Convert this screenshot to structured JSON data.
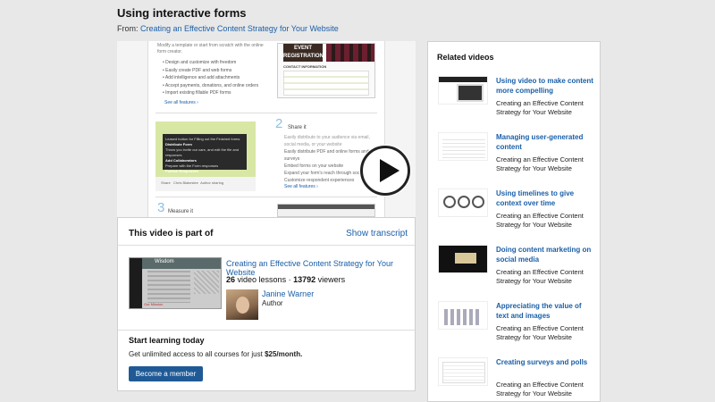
{
  "page": {
    "title": "Using interactive forms",
    "from_label": "From:",
    "from_course": "Creating an Effective Content Strategy for Your Website"
  },
  "video": {
    "blurb": "Modify a template or start from scratch with the online form creator.",
    "features": [
      "Design and customize with freedom",
      "Easily create PDF and web forms",
      "Add intelligence and add attachments",
      "Accept payments, donations, and online orders",
      "Import existing fillable PDF forms"
    ],
    "see_all": "See all features ›",
    "event_card": {
      "banner": "EVENT REGISTRATION",
      "section": "CONTACT INFORMATION"
    },
    "share_shot": {
      "lines": [
        "Leased button for Filling out the Finished forms",
        "Distribute Form",
        "Throw you invite our care, and edit the file and responses",
        "Add Collaborators",
        "Prepare with the Form responses",
        "Publish Responses"
      ],
      "user": "Chris Blakeslee",
      "user_role": "Author sharing",
      "share_label": "Share"
    },
    "step2_num": "2",
    "step2_label": "Share it",
    "share_intro": "Easily distribute to your audience via email, social media, or your website",
    "share_features": [
      "Easily distribute PDF and online forms and surveys",
      "Embed forms on your website",
      "Expand your form's reach through social",
      "Customize respondent experiences"
    ],
    "share_see_all": "See all features ›",
    "step3_num": "3",
    "step3_label": "Measure it",
    "play_label": "Play"
  },
  "course_panel": {
    "part_of": "This video is part of",
    "show_transcript": "Show transcript",
    "thumb_heading": "Wisdom",
    "thumb_caption": "Our Mission",
    "course_title": "Creating an Effective Content Strategy for Your Website",
    "lessons_count": "26",
    "lessons_label": "video lessons ·",
    "viewers_count": "13792",
    "viewers_label": "viewers",
    "author_name": "Janine Warner",
    "author_role": "Author",
    "start_learning": "Start learning today",
    "access_text": "Get unlimited access to all courses for just",
    "access_price": "$25/month.",
    "member_button": "Become a member"
  },
  "related": {
    "heading": "Related videos",
    "items": [
      {
        "title": "Using video to make content more compelling",
        "course": "Creating an Effective Content Strategy for Your Website"
      },
      {
        "title": "Managing user-generated content",
        "course": "Creating an Effective Content Strategy for Your Website"
      },
      {
        "title": "Using timelines to give context over time",
        "course": "Creating an Effective Content Strategy for Your Website"
      },
      {
        "title": "Doing content marketing on social media",
        "course": "Creating an Effective Content Strategy for Your Website"
      },
      {
        "title": "Appreciating the value of text and images",
        "course": "Creating an Effective Content Strategy for Your Website"
      },
      {
        "title": "Creating surveys and polls",
        "course": "Creating an Effective Content Strategy for Your Website"
      }
    ]
  },
  "colors": {
    "link": "#1a5fa8",
    "button": "#1f5a96",
    "background": "#e8e8e8"
  }
}
